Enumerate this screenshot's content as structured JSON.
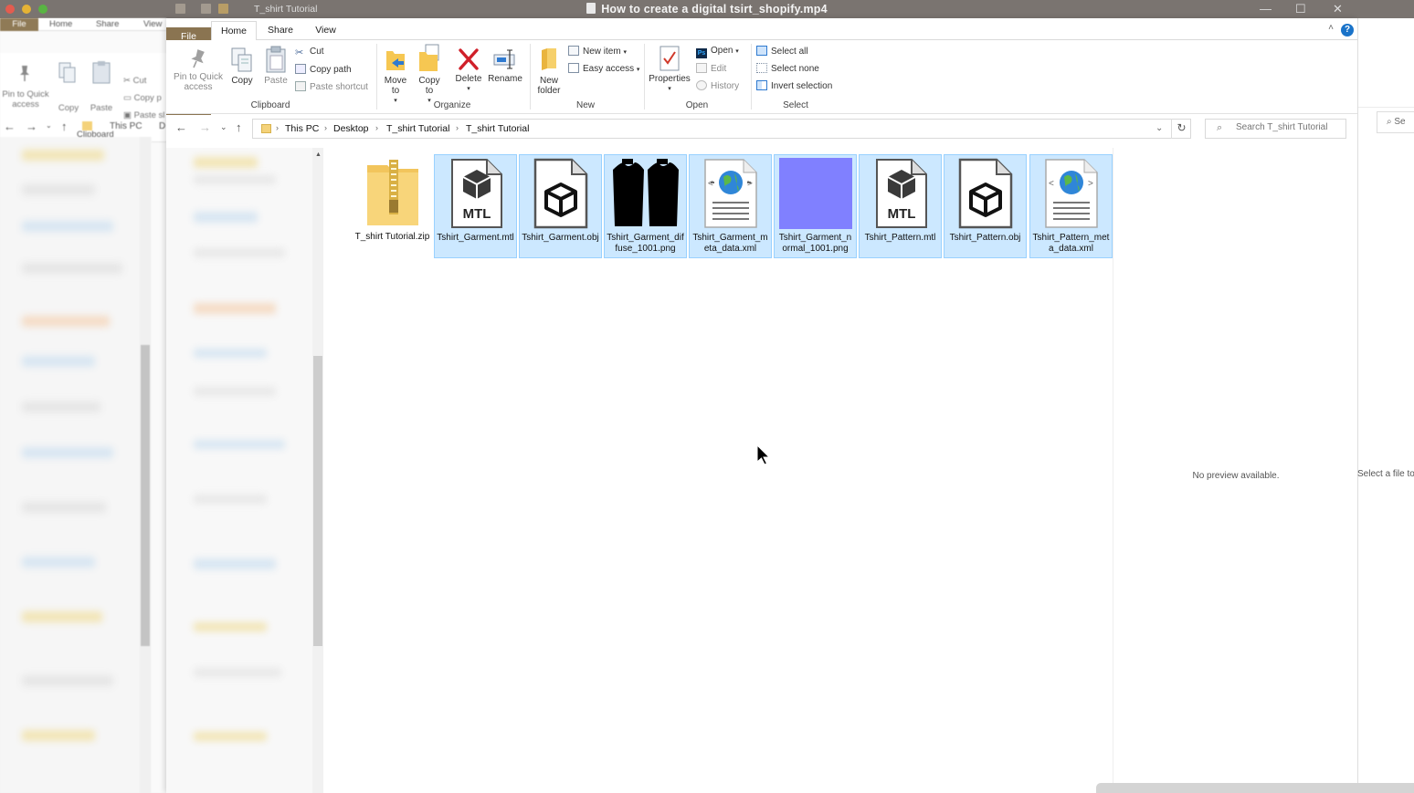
{
  "player": {
    "title": "How to create a digital tsirt_shopify.mp4"
  },
  "window": {
    "title": "T_shirt Tutorial",
    "min_icon": "—",
    "max_icon": "☐",
    "close_icon": "✕"
  },
  "background_window": {
    "tabs": [
      "File",
      "Home",
      "Share",
      "View"
    ],
    "ribbon": {
      "pin": "Pin to Quick access",
      "copy": "Copy",
      "paste": "Paste",
      "cut": "Cut",
      "copy_path": "Copy p",
      "paste_shortcut": "Paste sl",
      "group": "Clipboard"
    },
    "address": [
      "This PC",
      "D"
    ]
  },
  "tabs": {
    "file": "File",
    "home": "Home",
    "share": "Share",
    "view": "View"
  },
  "ribbon": {
    "pin": "Pin to Quick access",
    "copy": "Copy",
    "paste": "Paste",
    "cut": "Cut",
    "copy_path": "Copy path",
    "paste_shortcut": "Paste shortcut",
    "clipboard_group": "Clipboard",
    "move_to": "Move to",
    "copy_to": "Copy to",
    "delete": "Delete",
    "rename": "Rename",
    "organize_group": "Organize",
    "new_folder": "New folder",
    "new_item": "New item",
    "easy_access": "Easy access",
    "new_group": "New",
    "properties": "Properties",
    "open": "Open",
    "edit": "Edit",
    "history": "History",
    "open_group": "Open",
    "select_all": "Select all",
    "select_none": "Select none",
    "invert_selection": "Invert selection",
    "select_group": "Select"
  },
  "address": {
    "crumbs": [
      "This PC",
      "Desktop",
      "T_shirt Tutorial",
      "T_shirt Tutorial"
    ],
    "search_placeholder": "Search T_shirt Tutorial"
  },
  "files": [
    {
      "name": "T_shirt Tutorial.zip",
      "type": "zip",
      "selected": false
    },
    {
      "name": "Tshirt_Garment.mtl",
      "type": "mtl",
      "selected": true
    },
    {
      "name": "Tshirt_Garment.obj",
      "type": "obj",
      "selected": true
    },
    {
      "name": "Tshirt_Garment_diffuse_1001.png",
      "type": "png-shirt",
      "selected": true
    },
    {
      "name": "Tshirt_Garment_meta_data.xml",
      "type": "xml",
      "selected": true
    },
    {
      "name": "Tshirt_Garment_normal_1001.png",
      "type": "png-normal",
      "selected": true
    },
    {
      "name": "Tshirt_Pattern.mtl",
      "type": "mtl",
      "selected": true
    },
    {
      "name": "Tshirt_Pattern.obj",
      "type": "obj",
      "selected": true
    },
    {
      "name": "Tshirt_Pattern_meta_data.xml",
      "type": "xml",
      "selected": true
    }
  ],
  "mtl_label": "MTL",
  "preview": {
    "message": "No preview available."
  },
  "right_window": {
    "search_fragment": "Se",
    "message": "Select a file to"
  },
  "colors": {
    "file_tab": "#8a7451",
    "selection_bg": "#cce8ff",
    "selection_border": "#99d1ff",
    "normal_map": "#8080ff",
    "help": "#1a73c9",
    "delete_red": "#d0202a"
  }
}
